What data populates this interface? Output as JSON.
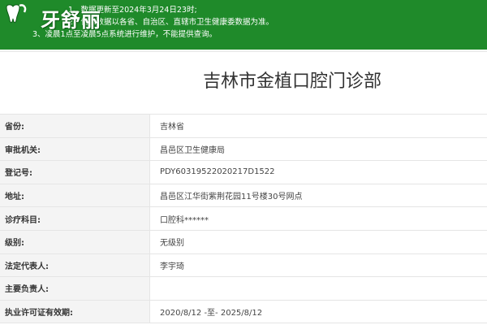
{
  "notice": {
    "lines": [
      "1、数据更新至2024年3月24日23时;",
      "2、信息数据以各省、自治区、直辖市卫生健康委数据为准。",
      "3、凌晨1点至凌晨5点系统进行维护，不能提供查询。"
    ],
    "partial_line1": "2024年3月24日23时;",
    "partial_line2": "省、自治区、直辖市卫生健康委数据为准。",
    "partial_line3": "凌晨1点至凌晨5点系统进行维护，不能提供查询。"
  },
  "logo": {
    "text": "牙舒丽",
    "icon": "tooth-icon"
  },
  "title": "吉林市金植口腔门诊部",
  "rows": [
    {
      "label": "省份:",
      "value": "吉林省"
    },
    {
      "label": "审批机关:",
      "value": "昌邑区卫生健康局"
    },
    {
      "label": "登记号:",
      "value": "PDY60319522020217D1522"
    },
    {
      "label": "地址:",
      "value": "昌邑区江华街紫荆花园11号楼30号网点"
    },
    {
      "label": "诊疗科目:",
      "value": "口腔科******"
    },
    {
      "label": "级别:",
      "value": "无级别"
    },
    {
      "label": "法定代表人:",
      "value": "李宇琦"
    },
    {
      "label": "主要负责人:",
      "value": ""
    },
    {
      "label": "执业许可证有效期:",
      "value": "2020/8/12 -至- 2025/8/12"
    }
  ],
  "colors": {
    "banner": "#1f8a2a",
    "label_bg": "#f4f4f4",
    "border": "#e5e5e5"
  }
}
